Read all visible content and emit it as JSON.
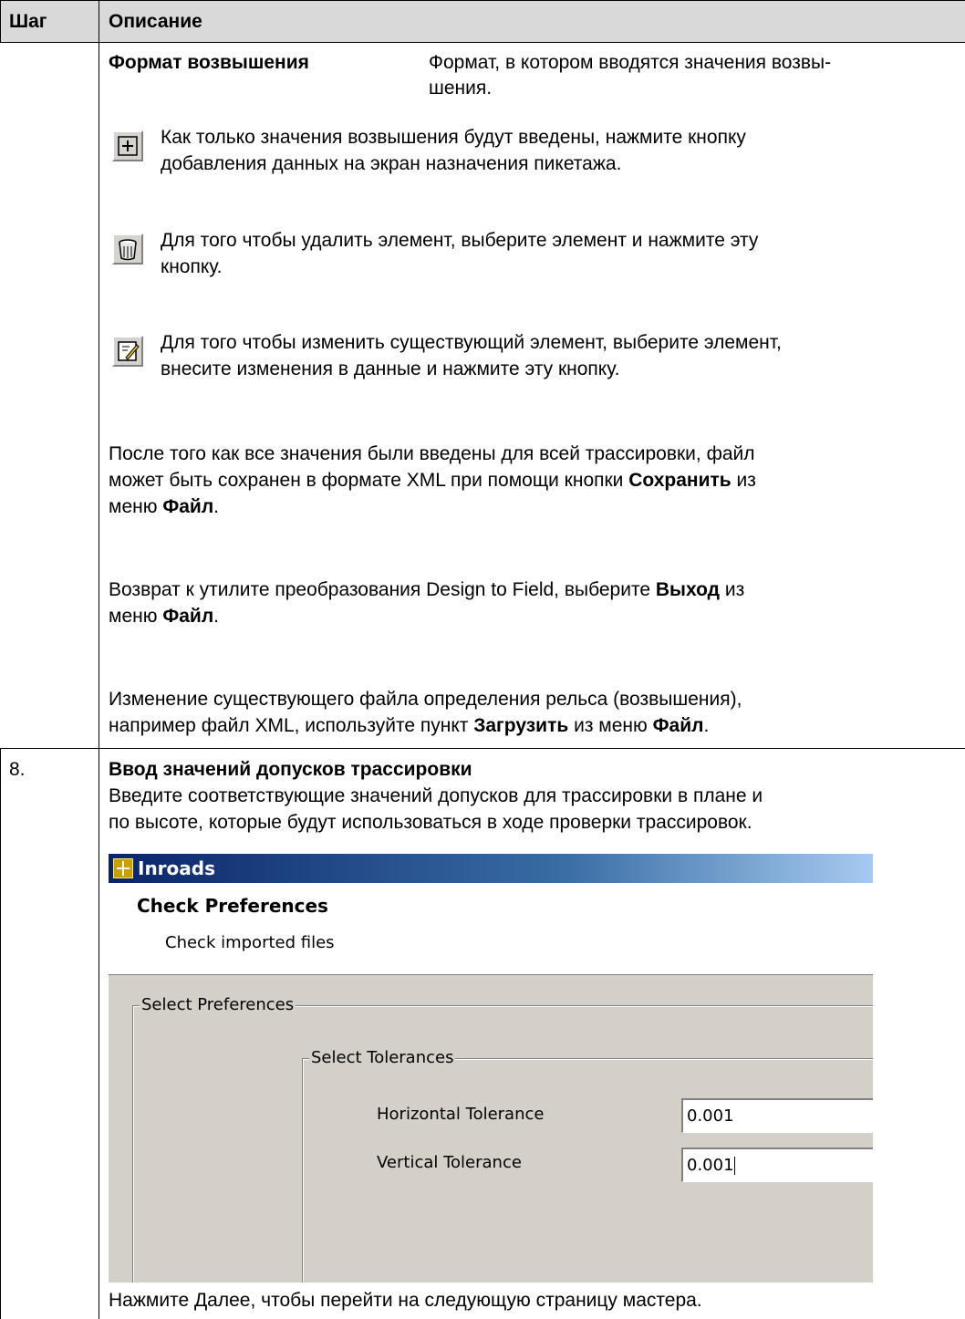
{
  "table": {
    "header_step": "Шаг",
    "header_desc": "Описание"
  },
  "row7": {
    "format_label": "Формат возвышения",
    "format_desc_1": "Формат, в котором вводятся значения возвы-",
    "format_desc_2": "шения.",
    "add_text_1": "Как только значения возвышения будут введены, нажмите кнопку",
    "add_text_2": "добавления данных на экран назначения пикетажа.",
    "delete_text_1": "Для того чтобы удалить элемент, выберите элемент и нажмите эту",
    "delete_text_2": "кнопку.",
    "edit_text_1": "Для того чтобы изменить существующий элемент, выберите элемент,",
    "edit_text_2": "внесите изменения в данные и нажмите эту кнопку.",
    "save_para_1": "После того как все значения были введены для всей трассировки, файл",
    "save_para_2a": "может быть сохранен в формате XML при помощи кнопки ",
    "save_para_2b": "Сохранить",
    "save_para_2c": " из",
    "save_para_3a": "меню ",
    "save_para_3b": "Файл",
    "save_para_3c": ".",
    "exit_para_1a": "Возврат к утилите преобразования Design to Field, выберите ",
    "exit_para_1b": "Выход",
    "exit_para_1c": " из",
    "exit_para_2a": "меню ",
    "exit_para_2b": "Файл",
    "exit_para_2c": ".",
    "load_para_1": "Изменение существующего файла определения рельса (возвышения),",
    "load_para_2a": "например файл XML, используйте пункт ",
    "load_para_2b": "Загрузить",
    "load_para_2c": " из меню ",
    "load_para_2d": "Файл",
    "load_para_2e": "."
  },
  "row8": {
    "step": "8.",
    "title": "Ввод значений допусков трассировки",
    "desc_1": "Введите соответствующие значений допусков для трассировки в плане и",
    "desc_2": "по высоте, которые будут использоваться в ходе проверки трассировок.",
    "footer": "Нажмите Далее, чтобы перейти на следующую страницу мастера."
  },
  "dialog": {
    "window_title": "Inroads",
    "heading": "Check Preferences",
    "subheading": "Check imported files",
    "group_preferences": "Select Preferences",
    "group_tolerances": "Select Tolerances",
    "horizontal_label": "Horizontal Tolerance",
    "horizontal_value": "0.001",
    "vertical_label": "Vertical Tolerance",
    "vertical_value": "0.001"
  },
  "icons": {
    "add": "plus-icon",
    "delete": "trash-icon",
    "edit": "edit-icon",
    "app": "inroads-app-icon"
  }
}
